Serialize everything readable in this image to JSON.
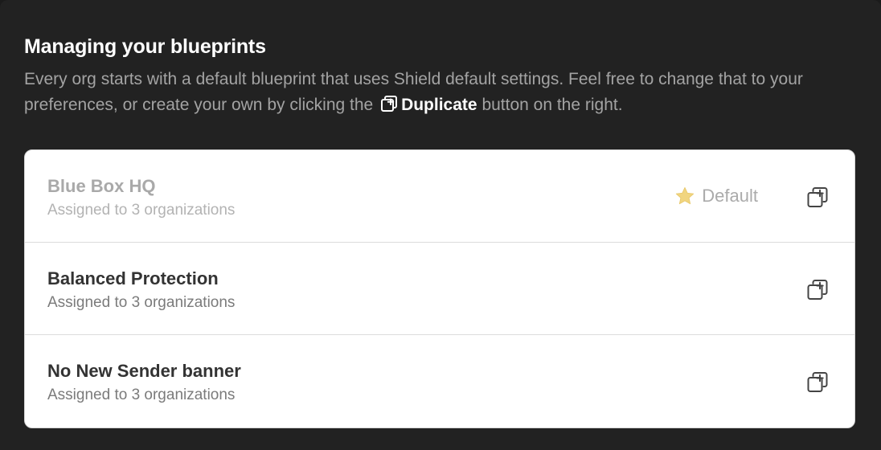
{
  "section": {
    "title": "Managing your blueprints",
    "description_before": "Every org starts with a default blueprint that uses Shield default settings. Feel free to change that to your preferences, or create your own by clicking the",
    "description_icon": "duplicate-icon",
    "description_strong": "Duplicate",
    "description_after": "button on the right."
  },
  "blueprints": [
    {
      "name": "Blue Box HQ",
      "assigned": "Assigned to 3 organizations",
      "is_default": true,
      "default_label": "Default",
      "default_icon": "star-icon",
      "action_icon": "duplicate-icon"
    },
    {
      "name": "Balanced Protection",
      "assigned": "Assigned to 3 organizations",
      "is_default": false,
      "action_icon": "duplicate-icon"
    },
    {
      "name": "No New Sender banner",
      "assigned": "Assigned to 3 organizations",
      "is_default": false,
      "action_icon": "duplicate-icon"
    }
  ],
  "colors": {
    "background": "#222222",
    "heading": "#ffffff",
    "description": "#a3a3a3",
    "card": "#ffffff",
    "star": "#f1d57f"
  }
}
